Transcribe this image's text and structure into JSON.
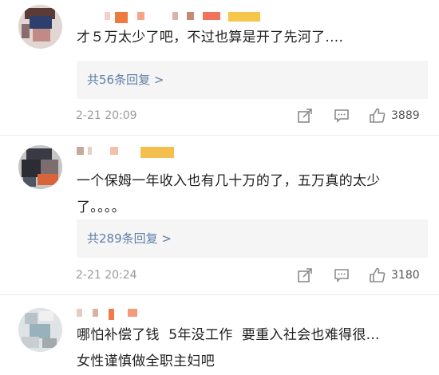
{
  "comments": [
    {
      "text": "才５万太少了吧，不过也算是开了先河了....",
      "replies": "共56条回复 >",
      "time": "2-21 20:09",
      "likes": "3889"
    },
    {
      "text": "一个保姆一年收入也有几十万的了，五万真的太少了。。。。",
      "replies": "共289条回复 >",
      "time": "2-21 20:24",
      "likes": "3180"
    },
    {
      "text": "哪怕补偿了钱  5年没工作  要重入社会也难得很...\n女性谨慎做全职主妇吧"
    }
  ],
  "icons": {
    "share": "share-icon",
    "comment": "comment-icon",
    "like": "thumbs-up-icon"
  },
  "colors": {
    "link": "#5f7fa7",
    "meta": "#9a9a9a",
    "reply_bg": "#f5f5f5"
  }
}
